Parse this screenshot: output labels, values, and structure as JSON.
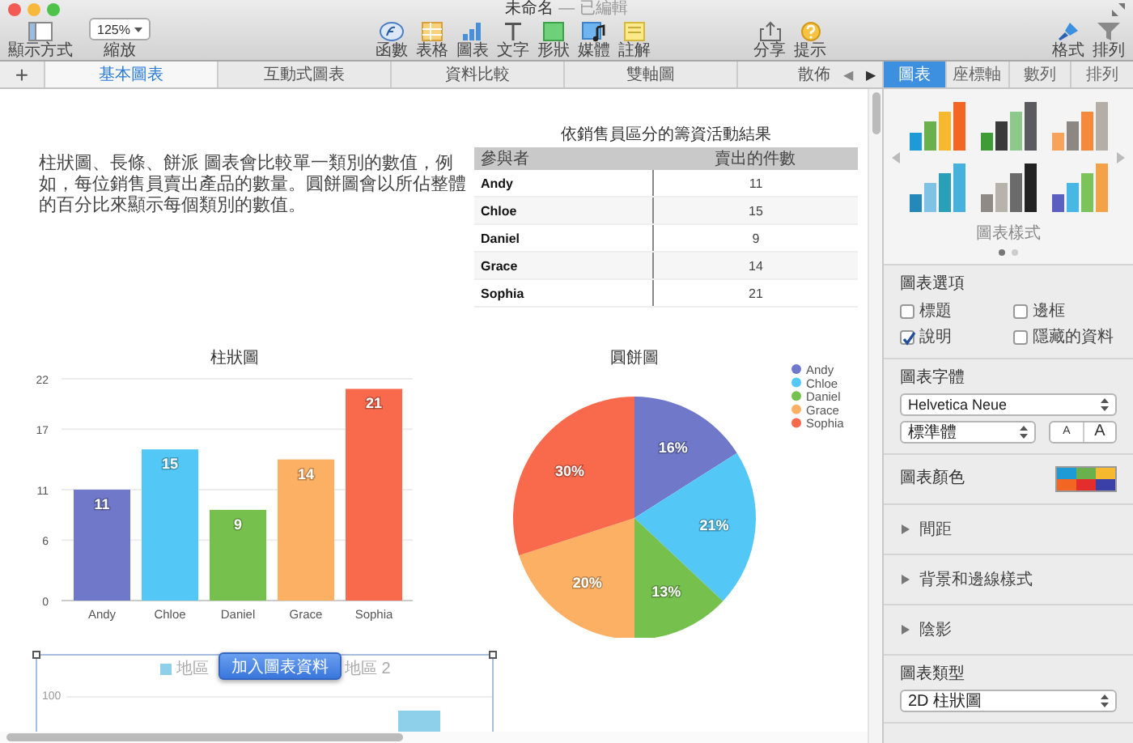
{
  "window": {
    "title": "未命名",
    "subtitle": "— 已編輯"
  },
  "toolbar": {
    "left": [
      {
        "kind": "view",
        "label": "顯示方式"
      },
      {
        "kind": "zoom",
        "label": "縮放",
        "value": "125%"
      }
    ],
    "center": [
      {
        "kind": "function",
        "label": "函數"
      },
      {
        "kind": "table",
        "label": "表格"
      },
      {
        "kind": "chart",
        "label": "圖表"
      },
      {
        "kind": "text",
        "label": "文字"
      },
      {
        "kind": "shape",
        "label": "形狀"
      },
      {
        "kind": "media",
        "label": "媒體"
      },
      {
        "kind": "comment",
        "label": "註解"
      }
    ],
    "sharing": [
      {
        "kind": "share",
        "label": "分享"
      },
      {
        "kind": "tips",
        "label": "提示"
      }
    ],
    "right": [
      {
        "kind": "format",
        "label": "格式"
      },
      {
        "kind": "organize",
        "label": "排列"
      }
    ]
  },
  "sheet_tabs": {
    "add": "+",
    "tabs": [
      {
        "label": "基本圖表",
        "selected": true
      },
      {
        "label": "互動式圖表",
        "selected": false
      },
      {
        "label": "資料比較",
        "selected": false
      },
      {
        "label": "雙軸圖",
        "selected": false
      },
      {
        "label": "散佈",
        "selected": false
      }
    ],
    "scroll_buttons": [
      {
        "glyph": "◀",
        "disabled": true
      },
      {
        "glyph": "▶",
        "disabled": false
      }
    ]
  },
  "canvas": {
    "description": "柱狀圖、長條、餅派 圖表會比較單一類別的數值，例如，每位銷售員賣出產品的數量。圓餅圖會以所佔整體的百分比來顯示每個類別的數值。",
    "table": {
      "title": "依銷售員區分的籌資活動結果",
      "columns": [
        "參與者",
        "賣出的件數"
      ],
      "rows": [
        [
          "Andy",
          "11"
        ],
        [
          "Chloe",
          "15"
        ],
        [
          "Daniel",
          "9"
        ],
        [
          "Grace",
          "14"
        ],
        [
          "Sophia",
          "21"
        ]
      ]
    },
    "bar_chart": {
      "bars": [
        {
          "color": "#6f78c9"
        },
        {
          "color": "#53c8f7"
        },
        {
          "color": "#76c04e"
        },
        {
          "color": "#fbb064"
        },
        {
          "color": "#f96a4d"
        }
      ],
      "chart_data": {
        "type": "bar",
        "title": "柱狀圖",
        "categories": [
          "Andy",
          "Chloe",
          "Daniel",
          "Grace",
          "Sophia"
        ],
        "values": [
          11,
          15,
          9,
          14,
          21
        ],
        "ylim": [
          0,
          22
        ],
        "yticks": [
          0,
          6,
          11,
          17,
          22
        ],
        "grid": true,
        "data_labels": true
      }
    },
    "pie_chart": {
      "slices": [
        {
          "color": "#6f78c9"
        },
        {
          "color": "#53c8f7"
        },
        {
          "color": "#76c04e"
        },
        {
          "color": "#fbb064"
        },
        {
          "color": "#f96a4d"
        }
      ],
      "chart_data": {
        "type": "pie",
        "title": "圓餅圖",
        "categories": [
          "Andy",
          "Chloe",
          "Daniel",
          "Grace",
          "Sophia"
        ],
        "values": [
          16,
          21,
          13,
          20,
          30
        ],
        "value_labels": [
          "16%",
          "21%",
          "13%",
          "20%",
          "30%"
        ],
        "legend": "right"
      }
    },
    "selected_chart": {
      "legend": [
        "地區",
        "地區 2"
      ],
      "ytick": "100",
      "button": "加入圖表資料"
    }
  },
  "inspector": {
    "tabs": [
      {
        "label": "圖表",
        "selected": true
      },
      {
        "label": "座標軸",
        "selected": false
      },
      {
        "label": "數列",
        "selected": false
      },
      {
        "label": "排列",
        "selected": false
      }
    ],
    "styles": {
      "label": "圖表樣式",
      "pages": [
        {
          "selected": true
        },
        {
          "selected": false
        }
      ]
    },
    "options": {
      "title": "圖表選項",
      "checkboxes": [
        {
          "label": "標題",
          "checked": false
        },
        {
          "label": "邊框",
          "checked": false
        },
        {
          "label": "說明",
          "checked": true
        },
        {
          "label": "隱藏的資料",
          "checked": false
        }
      ]
    },
    "font": {
      "title": "圖表字體",
      "family": "Helvetica Neue",
      "style": "標準體",
      "size_buttons": [
        "A",
        "A"
      ]
    },
    "colors": {
      "title": "圖表顏色"
    },
    "sections": [
      {
        "label": "間距",
        "expanded": false
      },
      {
        "label": "背景和邊線樣式",
        "expanded": false
      },
      {
        "label": "陰影",
        "expanded": false
      }
    ],
    "chart_type": {
      "title": "圖表類型",
      "value": "2D 柱狀圖"
    }
  }
}
